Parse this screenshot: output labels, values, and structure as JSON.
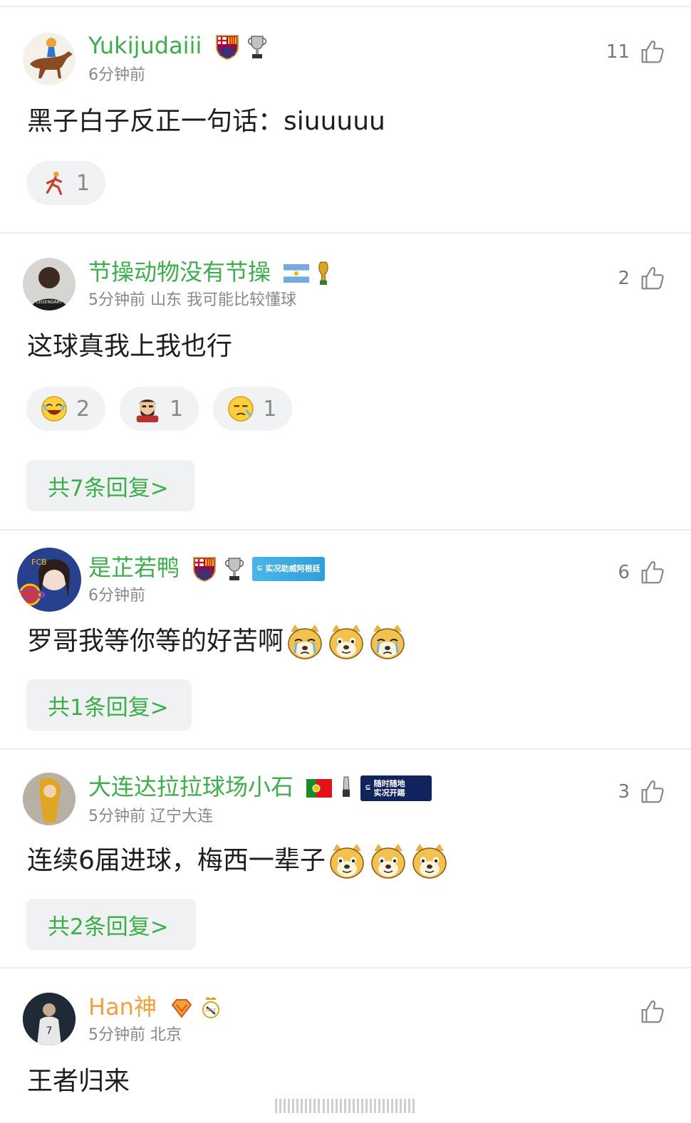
{
  "comments": [
    {
      "username": "Yukijudaiii",
      "meta": "6分钟前",
      "text": "黑子白子反正一句话：siuuuuu",
      "likes": "11",
      "reactions": [
        {
          "count": "1"
        }
      ]
    },
    {
      "username": "节操动物没有节操",
      "meta": "5分钟前 山东 我可能比较懂球",
      "text": "这球真我上我也行",
      "likes": "2",
      "reactions": [
        {
          "count": "2"
        },
        {
          "count": "1"
        },
        {
          "count": "1"
        }
      ],
      "replies": "共7条回复>"
    },
    {
      "username": "是芷若鸭",
      "meta": "6分钟前",
      "text": "罗哥我等你等的好苦啊",
      "likes": "6",
      "badge_text": "实况助威阿根廷",
      "replies": "共1条回复>"
    },
    {
      "username": "大连达拉拉球场小石",
      "meta": "5分钟前 辽宁大连",
      "text": "连续6届进球，梅西一辈子",
      "likes": "3",
      "badge_text_1": "随时随地",
      "badge_text_2": "实况开踢",
      "replies": "共2条回复>"
    },
    {
      "username": "Han神",
      "meta": "5分钟前 北京",
      "text": "王者归来",
      "likes": ""
    }
  ],
  "colors": {
    "username_green": "#3cae4a",
    "username_orange": "#f0a23a",
    "meta_gray": "#888888",
    "chip_bg": "#f1f2f3"
  },
  "icons": [
    "thumbs-up-icon",
    "barcelona-crest-icon",
    "trophy-icon",
    "argentina-flag-icon",
    "world-cup-icon",
    "portugal-flag-icon",
    "diamond-vip-icon",
    "real-madrid-crest-icon",
    "doge-emoji-icon",
    "laughing-emoji-icon"
  ]
}
